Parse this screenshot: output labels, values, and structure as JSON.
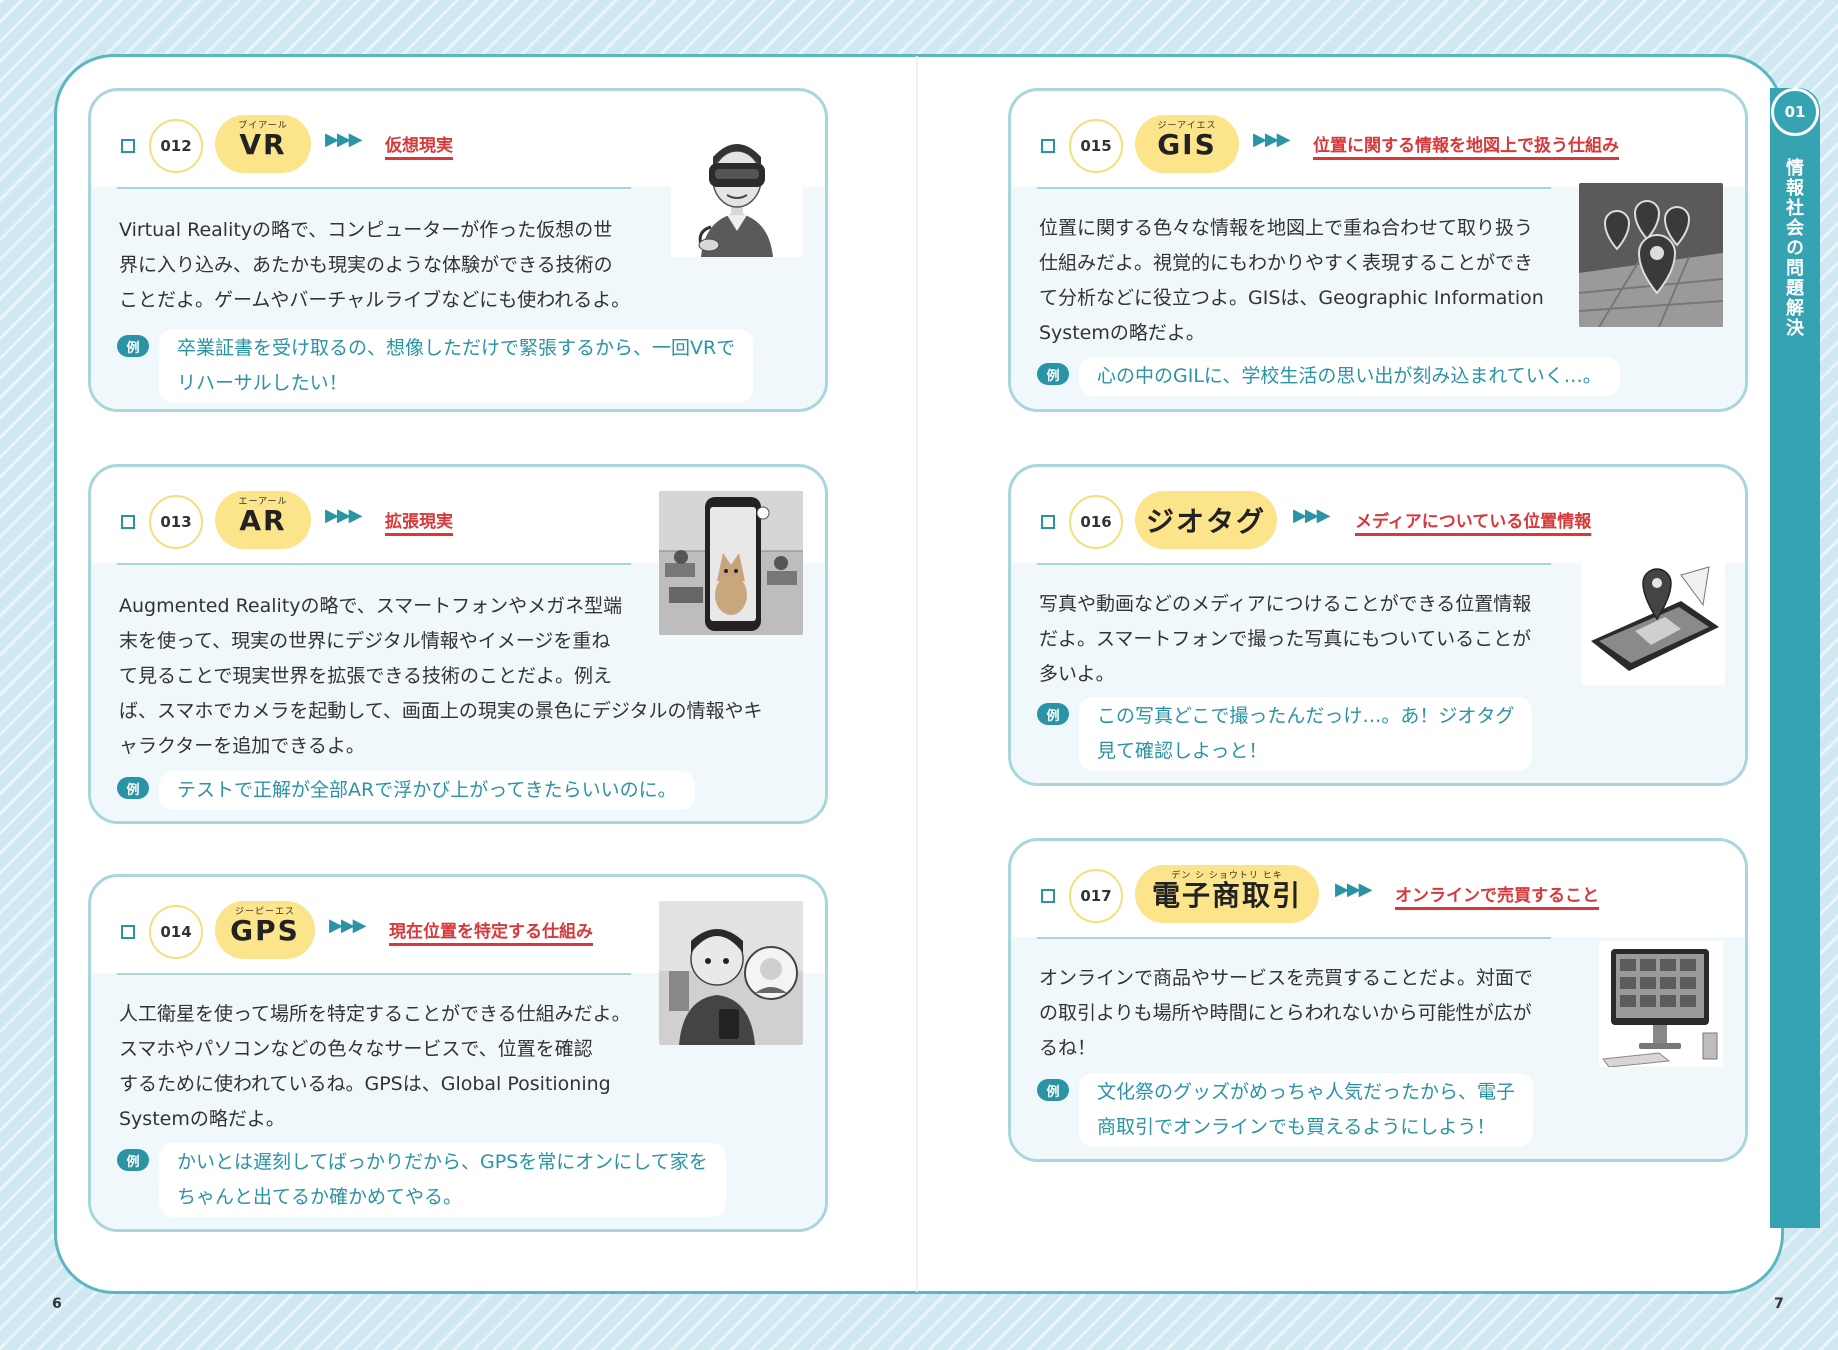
{
  "pages": {
    "left_number": "6",
    "right_number": "7"
  },
  "chapter": {
    "number": "01",
    "title": "情報社会の問題解決"
  },
  "cards": [
    {
      "id": "012",
      "term": "VR",
      "ruby": "ブイアール",
      "definition": "仮想現実",
      "description": [
        "Virtual Realityの略で、コンピューターが作った仮想の世",
        "界に入り込み、あたかも現実のような体験ができる技術の",
        "ことだよ。ゲームやバーチャルライブなどにも使われるよ。"
      ],
      "example_label": "例",
      "example": [
        "卒業証書を受け取るの、想像しただけで緊張するから、一回VRで",
        "リハーサルしたい！"
      ],
      "illustration": "vr-headset-person-icon"
    },
    {
      "id": "013",
      "term": "AR",
      "ruby": "エーアール",
      "definition": "拡張現実",
      "description": [
        "Augmented Realityの略で、スマートフォンやメガネ型端",
        "末を使って、現実の世界にデジタル情報やイメージを重ね",
        "て見ることで現実世界を拡張できる技術のことだよ。例え",
        "ば、スマホでカメラを起動して、画面上の現実の景色にデジタルの情報やキ",
        "ャラクターを追加できるよ。"
      ],
      "example_label": "例",
      "example": [
        "テストで正解が全部ARで浮かび上がってきたらいいのに。"
      ],
      "illustration": "ar-smartphone-classroom-icon"
    },
    {
      "id": "014",
      "term": "GPS",
      "ruby": "ジーピーエス",
      "definition": "現在位置を特定する仕組み",
      "description": [
        "人工衛星を使って場所を特定することができる仕組みだよ。",
        "スマホやパソコンなどの色々なサービスで、位置を確認",
        "するために使われているね。GPSは、Global Positioning",
        "Systemの略だよ。"
      ],
      "example_label": "例",
      "example": [
        "かいとは遅刻してばっかりだから、GPSを常にオンにして家を",
        "ちゃんと出てるか確かめてやる。"
      ],
      "illustration": "gps-student-phone-icon"
    },
    {
      "id": "015",
      "term": "GIS",
      "ruby": "ジーアイエス",
      "definition": "位置に関する情報を地図上で扱う仕組み",
      "description": [
        "位置に関する色々な情報を地図上で重ね合わせて取り扱う",
        "仕組みだよ。視覚的にもわかりやすく表現することができ",
        "て分析などに役立つよ。GISは、Geographic Information",
        "Systemの略だよ。"
      ],
      "example_label": "例",
      "example": [
        "心の中のGILに、学校生活の思い出が刻み込まれていく…。"
      ],
      "illustration": "map-pins-icon"
    },
    {
      "id": "016",
      "term": "ジオタグ",
      "ruby": "",
      "definition": "メディアについている位置情報",
      "description": [
        "写真や動画などのメディアにつけることができる位置情報",
        "だよ。スマートフォンで撮った写真にもついていることが",
        "多いよ。"
      ],
      "example_label": "例",
      "example": [
        "この写真どこで撮ったんだっけ…。あ！ジオタグ",
        "見て確認しよっと！"
      ],
      "illustration": "phone-location-pin-icon"
    },
    {
      "id": "017",
      "term": "電子商取引",
      "ruby": "デン シ ショウトリ ヒキ",
      "definition": "オンラインで売買すること",
      "description": [
        "オンラインで商品やサービスを売買することだよ。対面で",
        "の取引よりも場所や時間にとらわれないから可能性が広が",
        "るね！"
      ],
      "example_label": "例",
      "example": [
        "文化祭のグッズがめっちゃ人気だったから、電子",
        "商取引でオンラインでも買えるようにしよう！"
      ],
      "illustration": "online-shop-monitor-icon"
    }
  ]
}
